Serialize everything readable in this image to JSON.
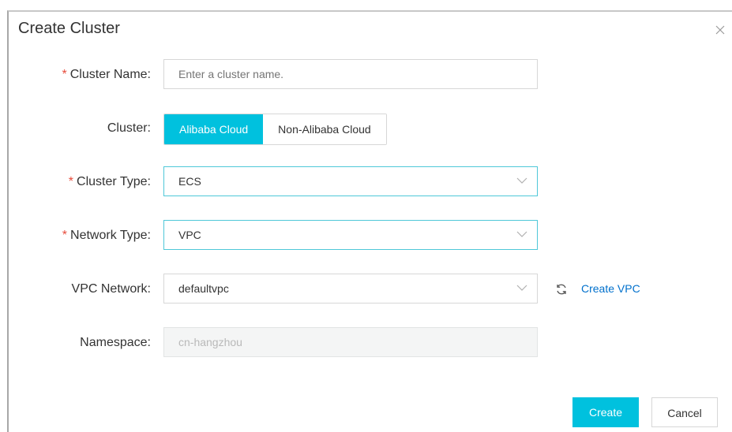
{
  "dialog": {
    "title": "Create Cluster",
    "close_icon": "close-icon"
  },
  "form": {
    "cluster_name": {
      "label": "Cluster Name:",
      "required_mark": "*",
      "placeholder": "Enter a cluster name."
    },
    "cluster": {
      "label": "Cluster:",
      "options": [
        "Alibaba Cloud",
        "Non-Alibaba Cloud"
      ],
      "selected": "Alibaba Cloud"
    },
    "cluster_type": {
      "label": "Cluster Type:",
      "required_mark": "*",
      "value": "ECS"
    },
    "network_type": {
      "label": "Network Type:",
      "required_mark": "*",
      "value": "VPC"
    },
    "vpc_network": {
      "label": "VPC Network:",
      "value": "defaultvpc",
      "refresh_icon": "refresh-icon",
      "create_link": "Create VPC"
    },
    "namespace": {
      "label": "Namespace:",
      "value": "cn-hangzhou"
    }
  },
  "footer": {
    "create_label": "Create",
    "cancel_label": "Cancel"
  },
  "colors": {
    "accent": "#00c1de",
    "link": "#0070cc",
    "required": "#e74c3c"
  }
}
